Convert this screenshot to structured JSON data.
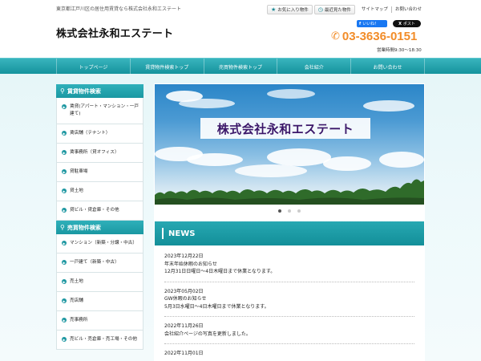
{
  "header": {
    "tagline": "東京都江戸川区の居住用賃貸なら株式会社永和エステート",
    "company_name": "株式会社永和エステート",
    "favorites_label": "お気に入り物件",
    "recent_label": "最近見た物件",
    "sitemap_label": "サイトマップ",
    "contact_link_label": "お問い合わせ",
    "fb_like_label": "いいね！",
    "x_post_label": "ポスト",
    "phone": "03-3636-0151",
    "hours": "営業時間9:30～18:30"
  },
  "nav": [
    {
      "label": "トップページ"
    },
    {
      "label": "賃貸物件検索トップ"
    },
    {
      "label": "売買物件検索トップ"
    },
    {
      "label": "会社紹介"
    },
    {
      "label": "お問い合わせ"
    }
  ],
  "sidebar": {
    "rental": {
      "heading": "賃貸物件検索",
      "items": [
        "賃貸(アパート・マンション・一戸建て)",
        "賃店舗（テナント）",
        "賃事務所（貸オフィス）",
        "貸駐車場",
        "貸土地",
        "貸ビル・貸倉庫・その他"
      ]
    },
    "sale": {
      "heading": "売買物件検索",
      "items": [
        "マンション（新築・分譲・中古）",
        "一戸建て（新築・中古）",
        "売土地",
        "売店舗",
        "売事務所",
        "売ビル・売倉庫・売工場・その他"
      ]
    }
  },
  "slider": {
    "banner_text": "株式会社永和エステート",
    "active_index": 0,
    "count": 3
  },
  "news": {
    "heading": "NEWS",
    "items": [
      {
        "date": "2023年12月22日",
        "title": "年末年始休暇のお知らせ",
        "body": "12月31日日曜日～4日木曜日まで休業となります。"
      },
      {
        "date": "2023年05月02日",
        "title": "GW休暇のお知らせ",
        "body": "5月3日水曜日～4日木曜日まで休業となります。"
      },
      {
        "date": "2022年11月26日",
        "title": "会社紹介ページの写真を更新しました。",
        "body": ""
      },
      {
        "date": "2022年11月01日",
        "title": "",
        "body": ""
      }
    ]
  },
  "colors": {
    "accent": "#1a98a2",
    "phone": "#f28c28",
    "banner_text": "#3b1769"
  }
}
